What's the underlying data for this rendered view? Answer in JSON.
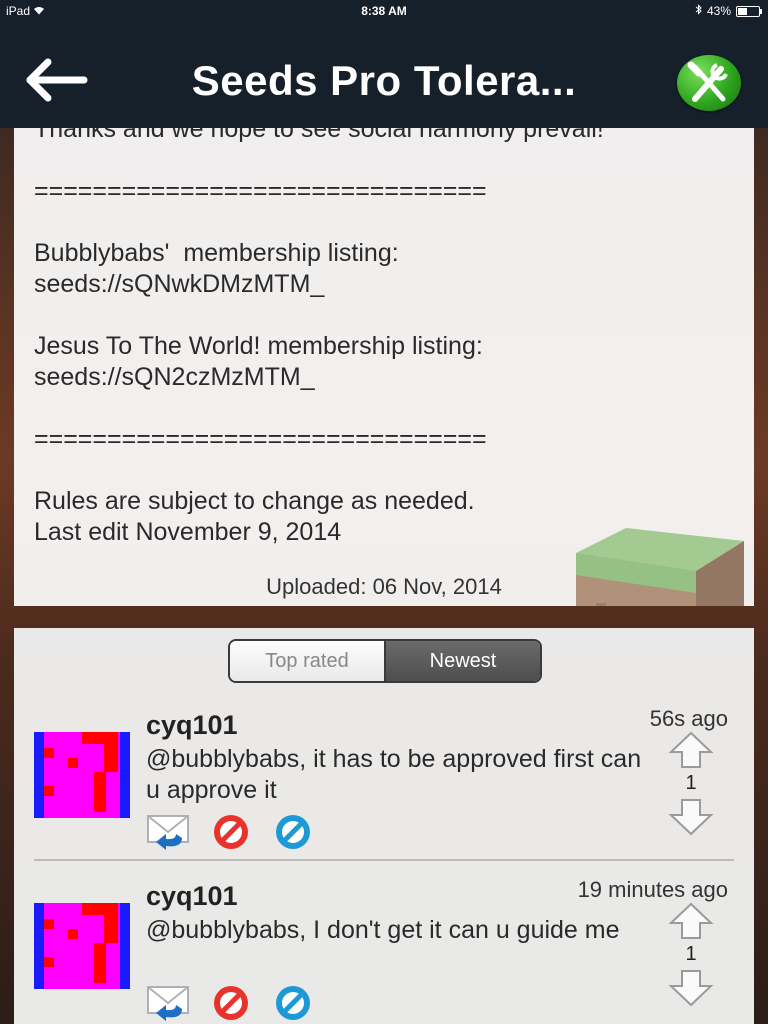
{
  "status_bar": {
    "device": "iPad",
    "time": "8:38 AM",
    "battery": "43%",
    "battery_level": 0.43
  },
  "nav": {
    "title": "Seeds Pro Tolera..."
  },
  "description": {
    "text": "Thanks and we hope to see social harmony prevail!\n\n===============================\n\nBubblybabs'  membership listing:\nseeds://sQNwkDMzMTM_\n\nJesus To The World! membership listing:\nseeds://sQN2czMzMTM_\n\n===============================\n\nRules are subject to change as needed.\nLast edit November 9, 2014",
    "uploaded": "Uploaded: 06 Nov, 2014"
  },
  "comments_tabs": {
    "top_rated": "Top rated",
    "newest": "Newest",
    "selected": "Newest"
  },
  "comments": [
    {
      "user": "cyq101",
      "time": "56s ago",
      "text": "@bubblybabs, it has to be approved first can u approve it",
      "votes": "1"
    },
    {
      "user": "cyq101",
      "time": "19 minutes ago",
      "text": "@bubblybabs, I don't get it can u guide me",
      "votes": "1"
    }
  ],
  "colors": {
    "navbar": "#16202a",
    "accent_green": "#2fa51e",
    "block_red": "#e8322c",
    "info_blue": "#1d9ad6",
    "avatar_magenta": "#ff00ff",
    "avatar_blue": "#1a1aff",
    "avatar_red": "#ff0000"
  }
}
